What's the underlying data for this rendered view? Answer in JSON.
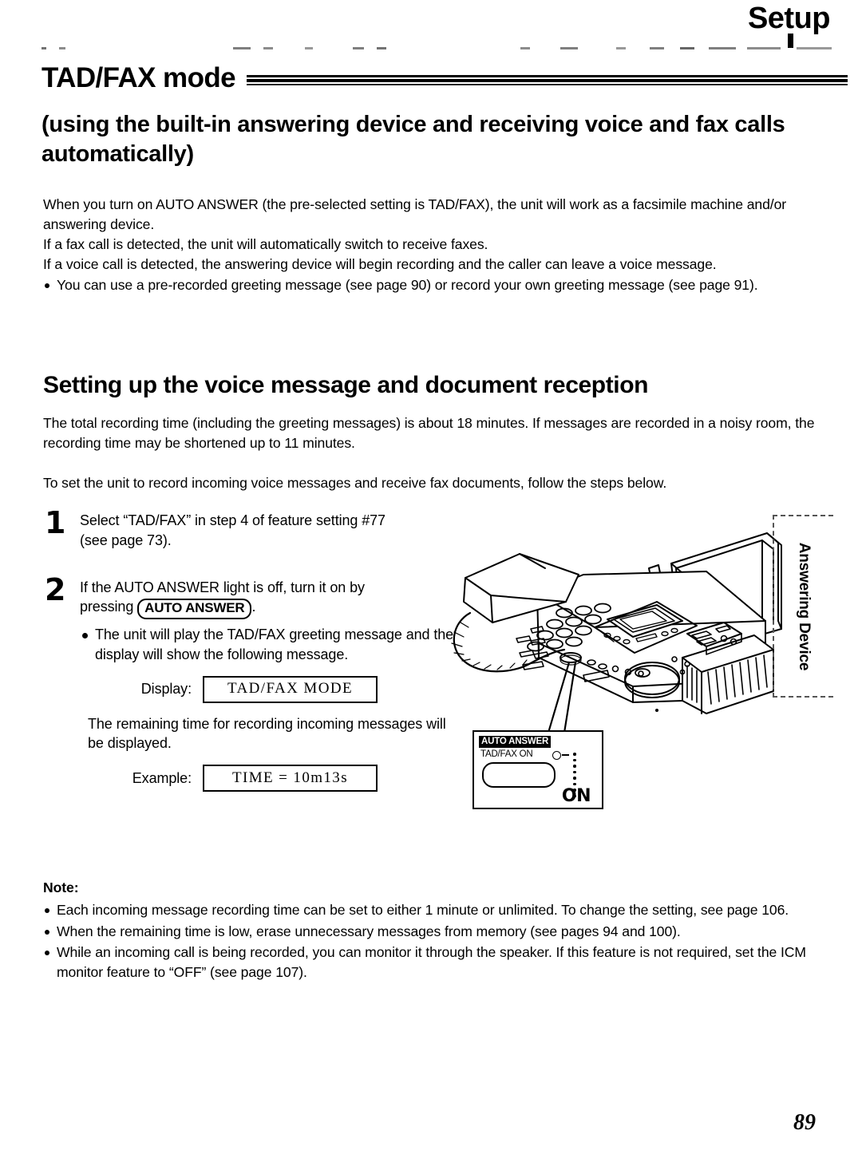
{
  "header": {
    "running_head": "Setup"
  },
  "section": {
    "title": "TAD/FAX mode",
    "subtitle": "(using the built-in answering device and receiving voice and fax calls automatically)"
  },
  "intro": {
    "lines": [
      "When you turn on AUTO ANSWER (the pre-selected setting is TAD/FAX), the unit will work as a facsimile machine and/or answering device.",
      "If a fax call is detected, the unit will automatically switch to receive faxes.",
      "If a voice call is detected, the answering device will begin recording and the caller can leave a voice message."
    ],
    "bullet": "You can use a pre-recorded greeting message (see page 90) or record your own greeting message (see page 91)."
  },
  "subsection": {
    "heading": "Setting up the voice message and document reception",
    "para1": "The total recording time (including the greeting messages) is about 18 minutes. If messages are recorded in a noisy room, the recording time may be shortened up to 11 minutes.",
    "para2": "To set the unit to record incoming voice messages and receive fax documents, follow the steps below."
  },
  "steps": {
    "step1": {
      "number": "1",
      "line1": "Select “TAD/FAX” in step 4 of feature setting #77",
      "line2": "(see page 73)."
    },
    "step2": {
      "number": "2",
      "line1": "If the AUTO ANSWER light is off, turn it on by",
      "pressing_prefix": "pressing",
      "keycap": "AUTO ANSWER",
      "pressing_suffix": ".",
      "bullet": "The unit will play the TAD/FAX greeting message and the display will show the following message.",
      "display_label": "Display:",
      "display_value": "TAD/FAX MODE",
      "middle_text": "The remaining time for recording incoming messages will be displayed.",
      "example_label": "Example:",
      "example_value": "TIME = 10m13s"
    }
  },
  "illustration": {
    "callout": {
      "title": "AUTO ANSWER",
      "subtitle": "TAD/FAX ON",
      "state": "ON"
    },
    "side_tab": "Answering Device"
  },
  "note": {
    "title": "Note:",
    "items": [
      "Each incoming message recording time can be set to either 1 minute or unlimited. To change the setting, see page 106.",
      "When the remaining time is low, erase unnecessary messages from memory (see pages 94 and 100).",
      "While an incoming call is being recorded, you can monitor it through the speaker. If this feature is not required, set the ICM monitor feature to “OFF” (see page 107)."
    ]
  },
  "footer": {
    "page_number": "89"
  },
  "colors": {
    "ink": "#000000",
    "paper": "#ffffff"
  }
}
